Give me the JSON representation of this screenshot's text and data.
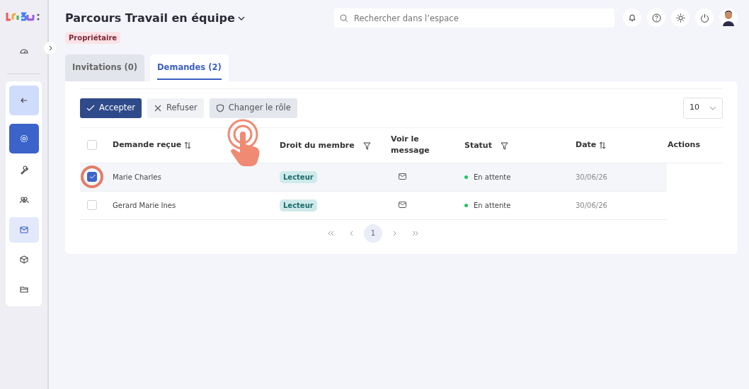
{
  "sidebar": {
    "items": [
      {
        "selected": false,
        "highlighted": false
      },
      {
        "selected": false,
        "highlighted": true
      },
      {
        "selected": true,
        "highlighted": false
      },
      {
        "selected": false,
        "highlighted": false
      },
      {
        "selected": false,
        "highlighted": false
      },
      {
        "selected": false,
        "highlighted": true
      },
      {
        "selected": false,
        "highlighted": false
      },
      {
        "selected": false,
        "highlighted": false
      }
    ]
  },
  "header": {
    "title": "Parcours Travail en équipe",
    "role": "Propriétaire",
    "search": {
      "placeholder": "Rechercher dans l’espace"
    }
  },
  "tabs": [
    {
      "label": "Invitations (0)",
      "selected": false
    },
    {
      "label": "Demandes (2)",
      "selected": true
    }
  ],
  "toolbar": {
    "buttons": [
      {
        "label": "Accepter",
        "kind": "primary"
      },
      {
        "label": "Refuser",
        "kind": "light"
      },
      {
        "label": "Changer le rôle",
        "kind": "muted"
      }
    ],
    "page_size": "10"
  },
  "table": {
    "all_checked": false,
    "columns": [
      {
        "label": "Demande reçue",
        "sortable": true,
        "filterable": false
      },
      {
        "label": "Droit du membre",
        "sortable": false,
        "filterable": true
      },
      {
        "label": "Voir le message",
        "sortable": false,
        "filterable": false
      },
      {
        "label": "Statut",
        "sortable": false,
        "filterable": true
      },
      {
        "label": "Date",
        "sortable": true,
        "filterable": false
      },
      {
        "label": "Actions",
        "sortable": false,
        "filterable": false
      }
    ],
    "rows": [
      {
        "selected": true,
        "highlighted": true,
        "name": "Marie Charles",
        "role": "Lecteur",
        "status": "En attente",
        "color": "#22c55e",
        "date": "30/06/26"
      },
      {
        "selected": false,
        "highlighted": false,
        "name": "Gerard Marie Ines",
        "role": "Lecteur",
        "status": "En attente",
        "color": "#22c55e",
        "date": "30/06/26"
      }
    ]
  },
  "pagination": {
    "pages": [
      {
        "label": "1",
        "selected": true
      }
    ]
  }
}
